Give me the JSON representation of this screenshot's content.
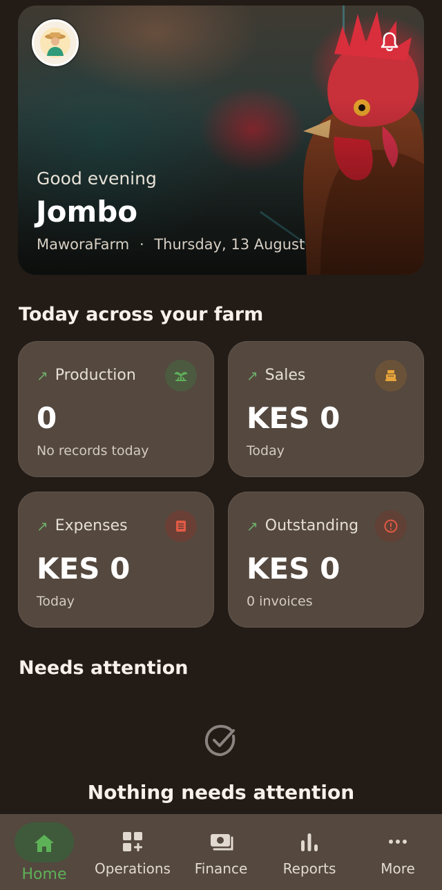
{
  "hero": {
    "greeting": "Good evening",
    "user_name": "Jombo",
    "farm_name": "MaworaFarm",
    "separator": "·",
    "date": "Thursday, 13 August",
    "avatar_icon": "farmer-avatar-icon",
    "notification_icon": "bell-icon"
  },
  "today": {
    "title": "Today across your farm",
    "cards": [
      {
        "label": "Production",
        "value": "0",
        "sub": "No records today",
        "icon": "sprout-icon",
        "icon_color": "#5fae5a",
        "icon_bg": "#4c5a40"
      },
      {
        "label": "Sales",
        "value": "KES 0",
        "sub": "Today",
        "icon": "cash-register-icon",
        "icon_color": "#e7a43a",
        "icon_bg": "#6a5238"
      },
      {
        "label": "Expenses",
        "value": "KES 0",
        "sub": "Today",
        "icon": "receipt-icon",
        "icon_color": "#e05a45",
        "icon_bg": "#6a4036"
      },
      {
        "label": "Outstanding",
        "value": "KES 0",
        "sub": "0 invoices",
        "icon": "alert-circle-icon",
        "icon_color": "#e05a45",
        "icon_bg": "#614035"
      }
    ]
  },
  "attention": {
    "title": "Needs attention",
    "empty_text": "Nothing needs attention",
    "empty_icon": "check-circle-icon"
  },
  "nav": {
    "items": [
      {
        "label": "Home",
        "icon": "home-icon",
        "active": true
      },
      {
        "label": "Operations",
        "icon": "grid-plus-icon",
        "active": false
      },
      {
        "label": "Finance",
        "icon": "money-icon",
        "active": false
      },
      {
        "label": "Reports",
        "icon": "bar-chart-icon",
        "active": false
      },
      {
        "label": "More",
        "icon": "more-dots-icon",
        "active": false
      }
    ],
    "active_color": "#5db257"
  }
}
